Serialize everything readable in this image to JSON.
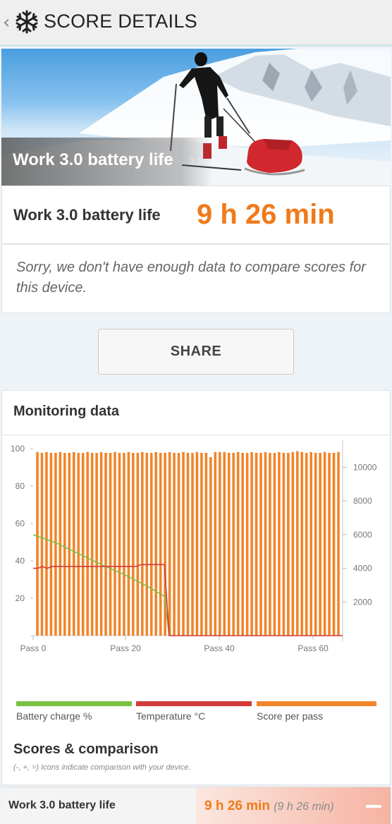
{
  "header": {
    "back_glyph": "‹",
    "logo_icon": "snowflake-icon",
    "title": "SCORE DETAILS"
  },
  "hero": {
    "title": "Work 3.0 battery life",
    "version": "3.0"
  },
  "result": {
    "label": "Work 3.0 battery life",
    "value": "9 h 26 min"
  },
  "sorry": {
    "text": "Sorry, we don't have enough data to compare scores for this device."
  },
  "share": {
    "label": "SHARE"
  },
  "monitoring": {
    "title": "Monitoring data",
    "legend": [
      {
        "label": "Battery charge %",
        "color": "#7ac143"
      },
      {
        "label": "Temperature °C",
        "color": "#d43a3a"
      },
      {
        "label": "Score per pass",
        "color": "#f0852a"
      }
    ]
  },
  "chart_data": {
    "type": "bar",
    "title": "",
    "x_tick_labels": [
      "Pass 0",
      "Pass 20",
      "Pass 40",
      "Pass 60"
    ],
    "x_tick_values": [
      0,
      20,
      40,
      60
    ],
    "left_axis": {
      "ticks": [
        20,
        40,
        60,
        80,
        100
      ],
      "ylim": [
        0,
        100
      ]
    },
    "right_axis": {
      "ticks": [
        2000,
        4000,
        6000,
        8000,
        10000
      ],
      "ylim": [
        0,
        11100
      ]
    },
    "grid": false,
    "series": [
      {
        "name": "Score per pass",
        "axis": "right",
        "kind": "bar",
        "x": [
          0,
          1,
          2,
          3,
          4,
          5,
          6,
          7,
          8,
          9,
          10,
          11,
          12,
          13,
          14,
          15,
          16,
          17,
          18,
          19,
          20,
          21,
          22,
          23,
          24,
          25,
          26,
          27,
          28,
          29,
          30,
          31,
          32,
          33,
          34,
          35,
          36,
          37,
          38,
          39,
          40,
          41,
          42,
          43,
          44,
          45,
          46,
          47,
          48,
          49,
          50,
          51,
          52,
          53,
          54,
          55,
          56,
          57,
          58,
          59,
          60,
          61,
          62,
          63,
          64,
          65,
          66
        ],
        "values": [
          10900,
          10850,
          10900,
          10850,
          10850,
          10900,
          10850,
          10850,
          10900,
          10850,
          10850,
          10900,
          10850,
          10850,
          10900,
          10850,
          10850,
          10900,
          10850,
          10850,
          10900,
          10850,
          10850,
          10900,
          10850,
          10850,
          10900,
          10850,
          10850,
          10900,
          10850,
          10850,
          10900,
          10850,
          10850,
          10900,
          10850,
          10850,
          10600,
          10900,
          10900,
          10900,
          10850,
          10850,
          10900,
          10850,
          10850,
          10900,
          10850,
          10850,
          10900,
          10850,
          10850,
          10900,
          10850,
          10850,
          10900,
          10950,
          10900,
          10850,
          10900,
          10850,
          10850,
          10900,
          10850,
          10850,
          10900
        ]
      },
      {
        "name": "Battery charge %",
        "axis": "left",
        "kind": "line",
        "x": [
          0,
          5,
          10,
          15,
          20,
          25,
          28,
          29
        ],
        "values": [
          54,
          49.5,
          43.5,
          37.5,
          32,
          25.5,
          21,
          0
        ]
      },
      {
        "name": "Temperature °C",
        "axis": "left",
        "kind": "line",
        "x": [
          0,
          1,
          2,
          3,
          4,
          10,
          20,
          22,
          23,
          28,
          29,
          66
        ],
        "values": [
          36,
          36,
          37,
          36,
          37,
          37,
          37,
          37,
          38,
          38,
          0,
          0
        ]
      }
    ]
  },
  "scores": {
    "title": "Scores & comparison",
    "subtitle": "(-, +, =) Icons indicate comparison with your device."
  },
  "row": {
    "label": "Work 3.0 battery life",
    "value": "9 h 26 min",
    "value_sub": "(9 h 26 min)",
    "action_icon": "minus-icon"
  }
}
